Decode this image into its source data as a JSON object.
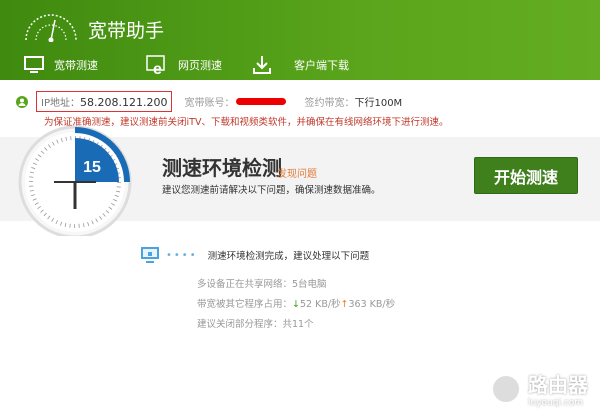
{
  "app": {
    "title": "宽带助手"
  },
  "nav": [
    {
      "label": "宽带测速",
      "icon": "monitor-icon"
    },
    {
      "label": "网页测速",
      "icon": "browser-icon"
    },
    {
      "label": "客户端下载",
      "icon": "download-icon"
    }
  ],
  "info": {
    "ip_label": "IP地址：",
    "ip_value": "58.208.121.200",
    "account_label": "宽带账号：",
    "plan_label": "签约带宽：",
    "plan_value": "下行100M",
    "warning": "为保证准确测速，建议测速前关闭iTV、下载和视频类软件，并确保在有线网络环境下进行测速。"
  },
  "check": {
    "timer": "15",
    "title": "测速环境检测",
    "tag": "发现问题",
    "subtitle": "建议您测速前请解决以下问题，确保测速数据准确。",
    "start_button": "开始测速"
  },
  "result": {
    "heading": "测速环境检测完成，建议处理以下问题",
    "shared_label": "多设备正在共享网络：",
    "shared_value": "5台电脑",
    "usage_label": "带宽被其它程序占用：",
    "down": "52 KB/秒",
    "up": "363 KB/秒",
    "close_label": "建议关闭部分程序：",
    "close_value": "共11个"
  },
  "watermark": {
    "title": "路由器",
    "url": "luyouqi.com"
  }
}
